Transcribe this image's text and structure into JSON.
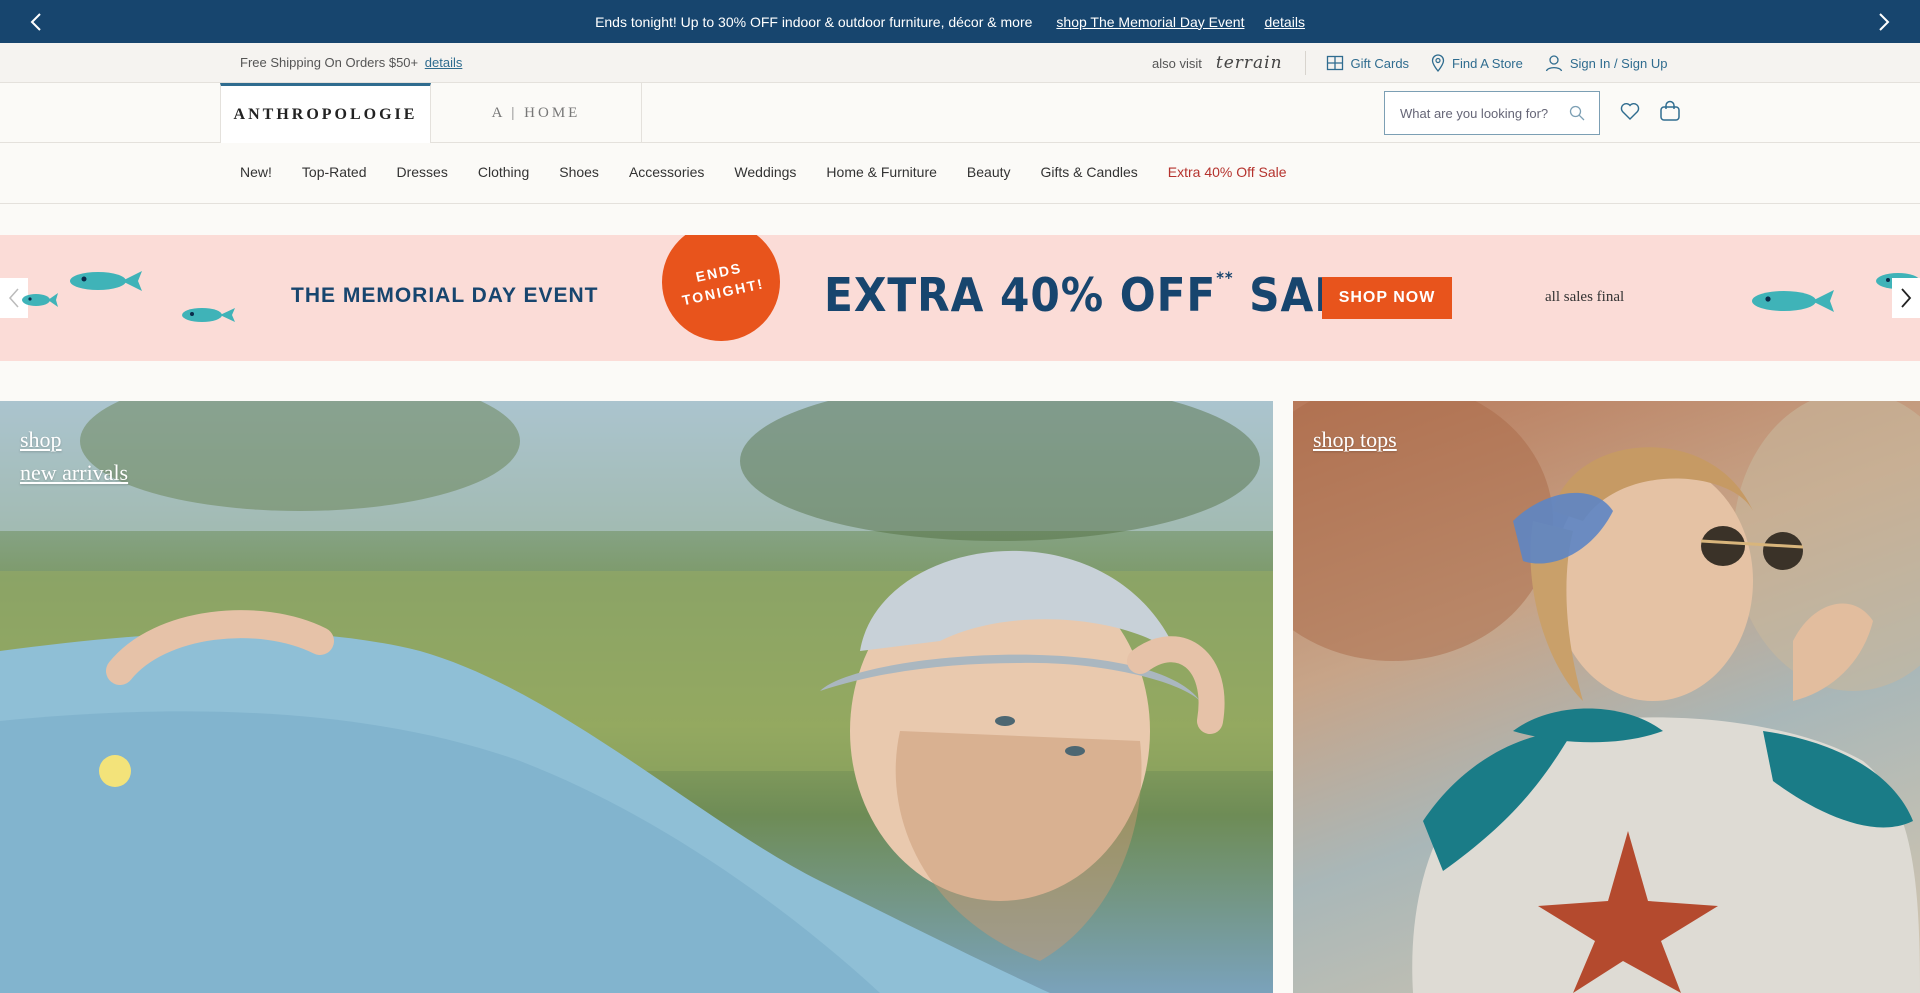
{
  "promo": {
    "message": "Ends tonight! Up to 30% OFF indoor & outdoor furniture, décor & more",
    "link": "shop The Memorial Day Event",
    "details": "details"
  },
  "utility": {
    "shipping": "Free Shipping On Orders $50+",
    "shipping_details": "details",
    "also_visit": "also visit",
    "terrain": "terrain",
    "gift_cards": "Gift Cards",
    "find_store": "Find A Store",
    "sign_in": "Sign In / Sign Up"
  },
  "header": {
    "brand": "ANTHROPOLOGIE",
    "home_brand": "A | HOME",
    "search_placeholder": "What are you looking for?"
  },
  "nav": {
    "items": [
      "New!",
      "Top-Rated",
      "Dresses",
      "Clothing",
      "Shoes",
      "Accessories",
      "Weddings",
      "Home & Furniture",
      "Beauty",
      "Gifts & Candles"
    ],
    "sale_item": "Extra 40% Off Sale"
  },
  "banner": {
    "event": "THE MEMORIAL DAY EVENT",
    "badge_line1": "ENDS",
    "badge_line2": "TONIGHT!",
    "sale": "EXTRA 40% OFF",
    "sale_mark": "**",
    "sale_word": "SALE",
    "cta": "SHOP NOW",
    "note": "all sales final"
  },
  "heroes": {
    "left_cta_line1": "shop",
    "left_cta_line2": "new arrivals",
    "right_cta": "shop tops"
  },
  "colors": {
    "promo_bg": "#17456e",
    "accent_blue": "#2f6c8f",
    "sale_red": "#b5332e",
    "banner_bg": "#fbdcd7",
    "orange": "#e8541c"
  }
}
